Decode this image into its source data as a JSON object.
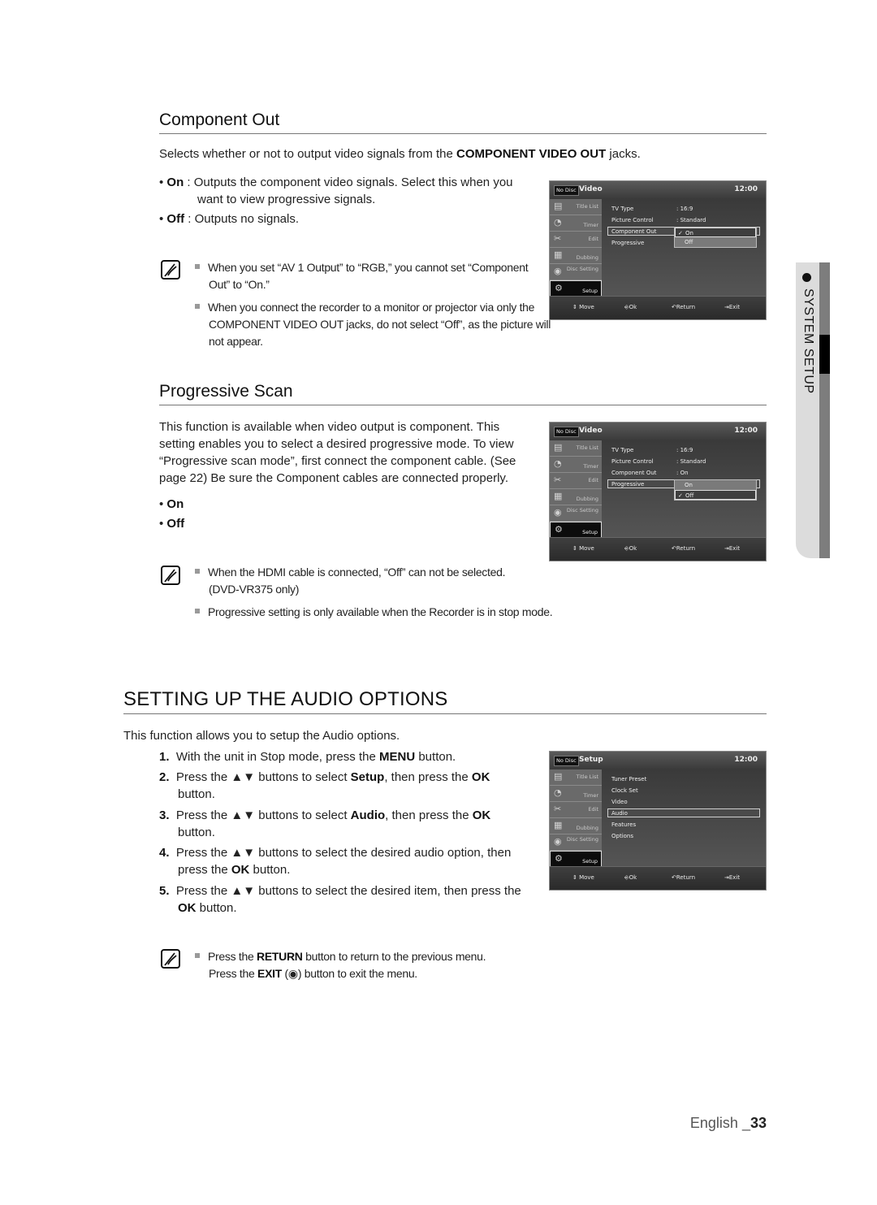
{
  "component_out": {
    "heading": "Component Out",
    "intro_pre": "Selects whether or not to output video signals from the ",
    "intro_bold": "COMPONENT VIDEO OUT",
    "intro_post": " jacks.",
    "options": [
      {
        "label": "On",
        "desc": " : Outputs the component video signals. Select this when you",
        "desc2": "want to view progressive signals."
      },
      {
        "label": "Off",
        "desc": " : Outputs no signals."
      }
    ],
    "notes": [
      {
        "line1": "When you set “AV 1 Output” to “RGB,” you cannot set “Component",
        "line2": "Out” to “On.”"
      },
      {
        "line1": "When you connect the recorder to a monitor or projector via only the",
        "line2": "COMPONENT VIDEO OUT jacks, do not select “Off”, as the picture will",
        "line3": "not appear."
      }
    ]
  },
  "progressive_scan": {
    "heading": "Progressive Scan",
    "body_lines": [
      "This function is available when video output is component. This",
      "setting enables you to select a desired progressive mode. To view",
      "“Progressive scan mode”, first connect the component cable. (See",
      "page 22) Be sure the Component cables are connected properly."
    ],
    "options": [
      "On",
      "Off"
    ],
    "notes": [
      {
        "line1": "When the HDMI cable is connected, “Off” can not be selected.",
        "line2": "(DVD-VR375 only)"
      },
      {
        "line1": "Progressive setting is only available when the Recorder is in stop mode."
      }
    ]
  },
  "audio_options": {
    "heading": "SETTING UP THE AUDIO OPTIONS",
    "intro": "This function allows you to setup the Audio options.",
    "steps": [
      {
        "num": "1.",
        "parts": [
          "With the unit in Stop mode, press the ",
          "MENU",
          " button."
        ]
      },
      {
        "num": "2.",
        "parts": [
          "Press the ▲▼ buttons to select ",
          "Setup",
          ", then press the ",
          "OK"
        ],
        "line2": "button."
      },
      {
        "num": "3.",
        "parts": [
          "Press the ▲▼ buttons to select ",
          "Audio",
          ", then press the ",
          "OK"
        ],
        "line2": "button."
      },
      {
        "num": "4.",
        "parts": [
          "Press the ▲▼ buttons to select the desired audio option, then"
        ],
        "line2_parts": [
          "press the ",
          "OK",
          " button."
        ]
      },
      {
        "num": "5.",
        "parts": [
          "Press the ▲▼ buttons to select the desired item, then press the"
        ],
        "line2_parts": [
          "OK",
          " button."
        ]
      }
    ],
    "note": {
      "line1_parts": [
        "Press the ",
        "RETURN",
        " button to return to the previous menu."
      ],
      "line2_parts": [
        "Press the ",
        "EXIT",
        " (",
        "◉",
        ") button to exit the menu."
      ]
    }
  },
  "tv_menus": [
    {
      "badge": "No Disc",
      "title": "Video",
      "clock": "12:00",
      "sidebar": [
        "Title List",
        "Timer",
        "Edit",
        "Dubbing",
        "Disc Setting",
        "Setup"
      ],
      "active_sidebar": "Setup",
      "rows": [
        {
          "label": "TV Type",
          "value": ": 16:9"
        },
        {
          "label": "Picture Control",
          "value": ": Standard"
        },
        {
          "label": "Component Out",
          "value": ""
        },
        {
          "label": "Progressive",
          "value": ""
        }
      ],
      "selected_row": "Component Out",
      "dropdown": [
        {
          "label": "On",
          "checked": true
        },
        {
          "label": "Off",
          "checked": false
        }
      ],
      "footer": [
        "Move",
        "Ok",
        "Return",
        "Exit"
      ]
    },
    {
      "badge": "No Disc",
      "title": "Video",
      "clock": "12:00",
      "sidebar": [
        "Title List",
        "Timer",
        "Edit",
        "Dubbing",
        "Disc Setting",
        "Setup"
      ],
      "active_sidebar": "Setup",
      "rows": [
        {
          "label": "TV Type",
          "value": ": 16:9"
        },
        {
          "label": "Picture Control",
          "value": ": Standard"
        },
        {
          "label": "Component Out",
          "value": ": On"
        },
        {
          "label": "Progressive",
          "value": ""
        }
      ],
      "selected_row": "Progressive",
      "dropdown": [
        {
          "label": "On",
          "checked": false
        },
        {
          "label": "Off",
          "checked": true
        }
      ],
      "footer": [
        "Move",
        "Ok",
        "Return",
        "Exit"
      ]
    },
    {
      "badge": "No Disc",
      "title": "Setup",
      "clock": "12:00",
      "sidebar": [
        "Title List",
        "Timer",
        "Edit",
        "Dubbing",
        "Disc Setting",
        "Setup"
      ],
      "active_sidebar": "Setup",
      "rows": [
        {
          "label": "Tuner Preset",
          "value": ""
        },
        {
          "label": "Clock Set",
          "value": ""
        },
        {
          "label": "Video",
          "value": ""
        },
        {
          "label": "Audio",
          "value": ""
        },
        {
          "label": "Features",
          "value": ""
        },
        {
          "label": "Options",
          "value": ""
        }
      ],
      "selected_row": "Audio",
      "footer": [
        "Move",
        "Ok",
        "Return",
        "Exit"
      ]
    }
  ],
  "side_tab": {
    "label": "SYSTEM SETUP"
  },
  "footer": {
    "language": "English _",
    "page": "33"
  }
}
